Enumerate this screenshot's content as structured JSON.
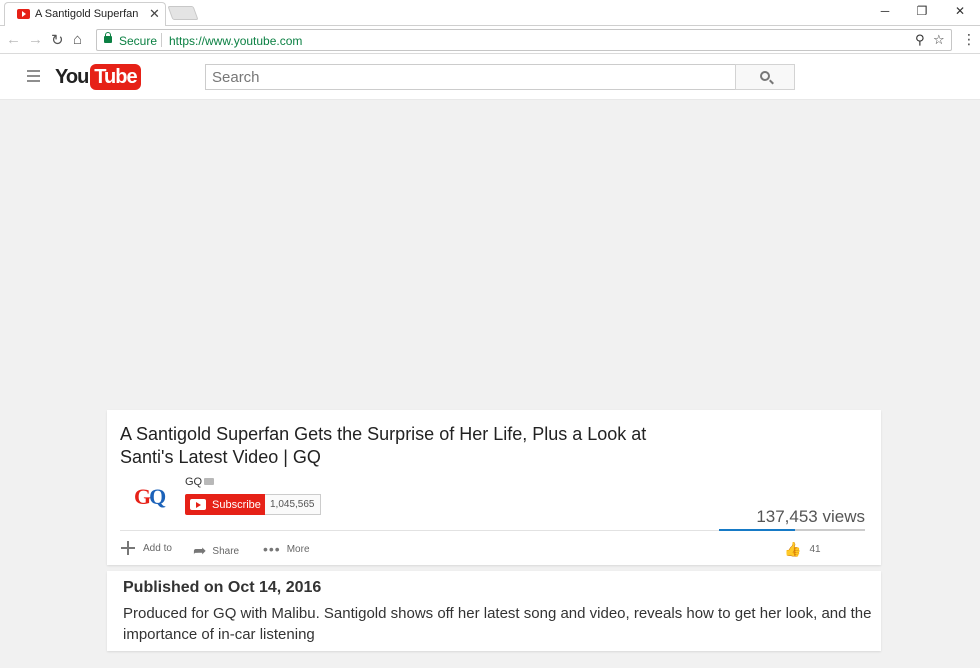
{
  "browser": {
    "tab_title": "A Santigold Superfan",
    "secure_label": "Secure",
    "url": "https://www.youtube.com"
  },
  "header": {
    "logo_you": "You",
    "logo_tube": "Tube",
    "search_placeholder": "Search"
  },
  "video": {
    "title_line1": "A Santigold Superfan Gets the Surprise of Her Life, Plus a Look at",
    "title_line2": "Santi's Latest Video | GQ",
    "channel_name": "GQ",
    "subscribe_label": "Subscribe",
    "subscriber_count": "1,045,565",
    "views": "137,453 views",
    "like_ratio": 0.52,
    "actions": {
      "add_to": "Add to",
      "share": "Share",
      "more": "More"
    },
    "likes": "41"
  },
  "description": {
    "published": "Published on Oct 14, 2016",
    "text": "Produced for GQ with Malibu. Santigold shows off her latest song and video, reveals how to get her look, and the importance of in-car listening"
  },
  "colors": {
    "brand_red": "#e62117",
    "link_blue": "#167ac6",
    "secure_green": "#0b8043"
  }
}
